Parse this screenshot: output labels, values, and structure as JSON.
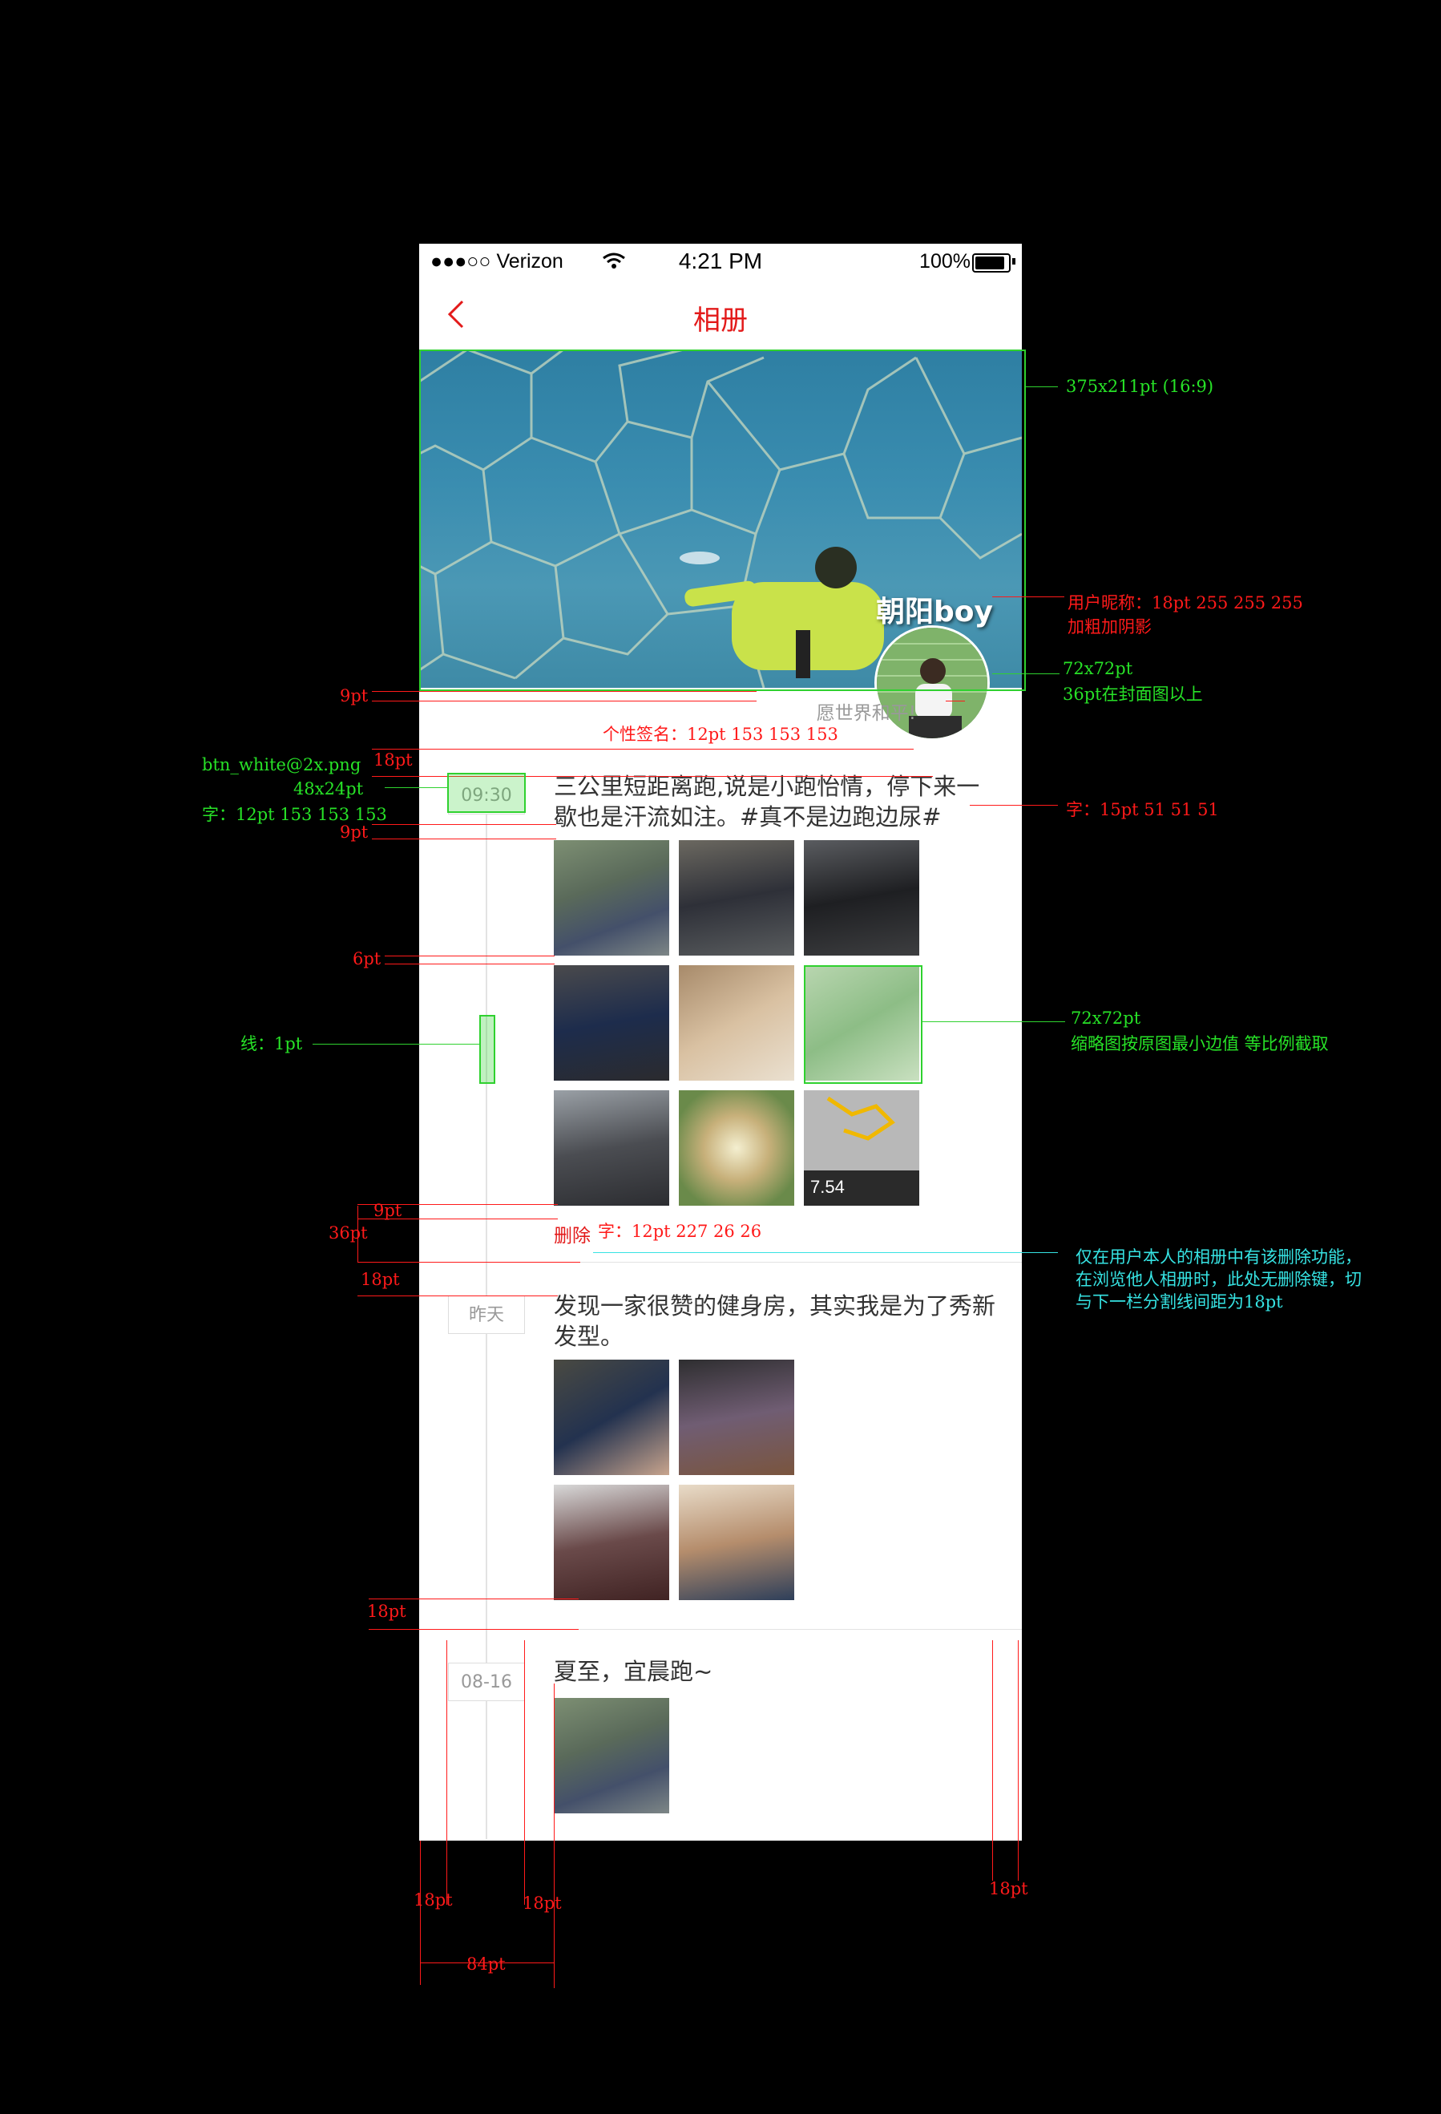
{
  "status_bar": {
    "carrier": "●●●○○ Verizon",
    "wifi_icon": "wifi-icon",
    "time": "4:21 PM",
    "battery": "100%"
  },
  "nav": {
    "back_icon": "chevron-left-icon",
    "title": "相册"
  },
  "profile": {
    "nickname": "朝阳boy",
    "signature": "愿世界和平!"
  },
  "posts": [
    {
      "date": "09:30",
      "text": "三公里短距离跑,说是小跑怡情，停下来一歇也是汗流如注。#真不是边跑边尿#",
      "delete_label": "删除"
    },
    {
      "date": "昨天",
      "text": "发现一家很赞的健身房，其实我是为了秀新发型。"
    },
    {
      "date": "08-16",
      "text": "夏至，宜晨跑~"
    }
  ],
  "annotations": {
    "cover_size": "375x211pt (16:9)",
    "nickname_spec_1": "用户昵称：18pt 255 255 255",
    "nickname_spec_2": "加粗加阴影",
    "avatar_spec_1": "72x72pt",
    "avatar_spec_2": "36pt在封面图以上",
    "gap_9pt_a": "9pt",
    "signature_spec": "个性签名：12pt 153 153 153",
    "gap_18pt_a": "18pt",
    "btn_spec_1": "btn_white@2x.png",
    "btn_spec_2": "48x24pt",
    "btn_spec_3": "字：12pt 153 153 153",
    "text_spec": "字：15pt 51 51 51",
    "gap_9pt_b": "9pt",
    "gap_6pt": "6pt",
    "line_spec": "线：1pt",
    "thumb_spec_1": "72x72pt",
    "thumb_spec_2": "缩略图按原图最小边值 等比例截取",
    "gap_9pt_c": "9pt",
    "gap_36pt": "36pt",
    "delete_spec": "字：12pt 227 26 26",
    "gap_18pt_b": "18pt",
    "delete_note_1": "仅在用户本人的相册中有该删除功能，",
    "delete_note_2": "在浏览他人相册时，此处无删除键，切",
    "delete_note_3": "与下一栏分割线间距为18pt",
    "gap_18pt_c": "18pt",
    "bottom_18pt_left": "18pt",
    "bottom_18pt_mid": "18pt",
    "bottom_18pt_right": "18pt",
    "bottom_84pt": "84pt"
  },
  "colors": {
    "accent": "#e31a1a",
    "annot_red": "#ff1a1a",
    "annot_green": "#27e227",
    "annot_cyan": "#36e3e3"
  }
}
